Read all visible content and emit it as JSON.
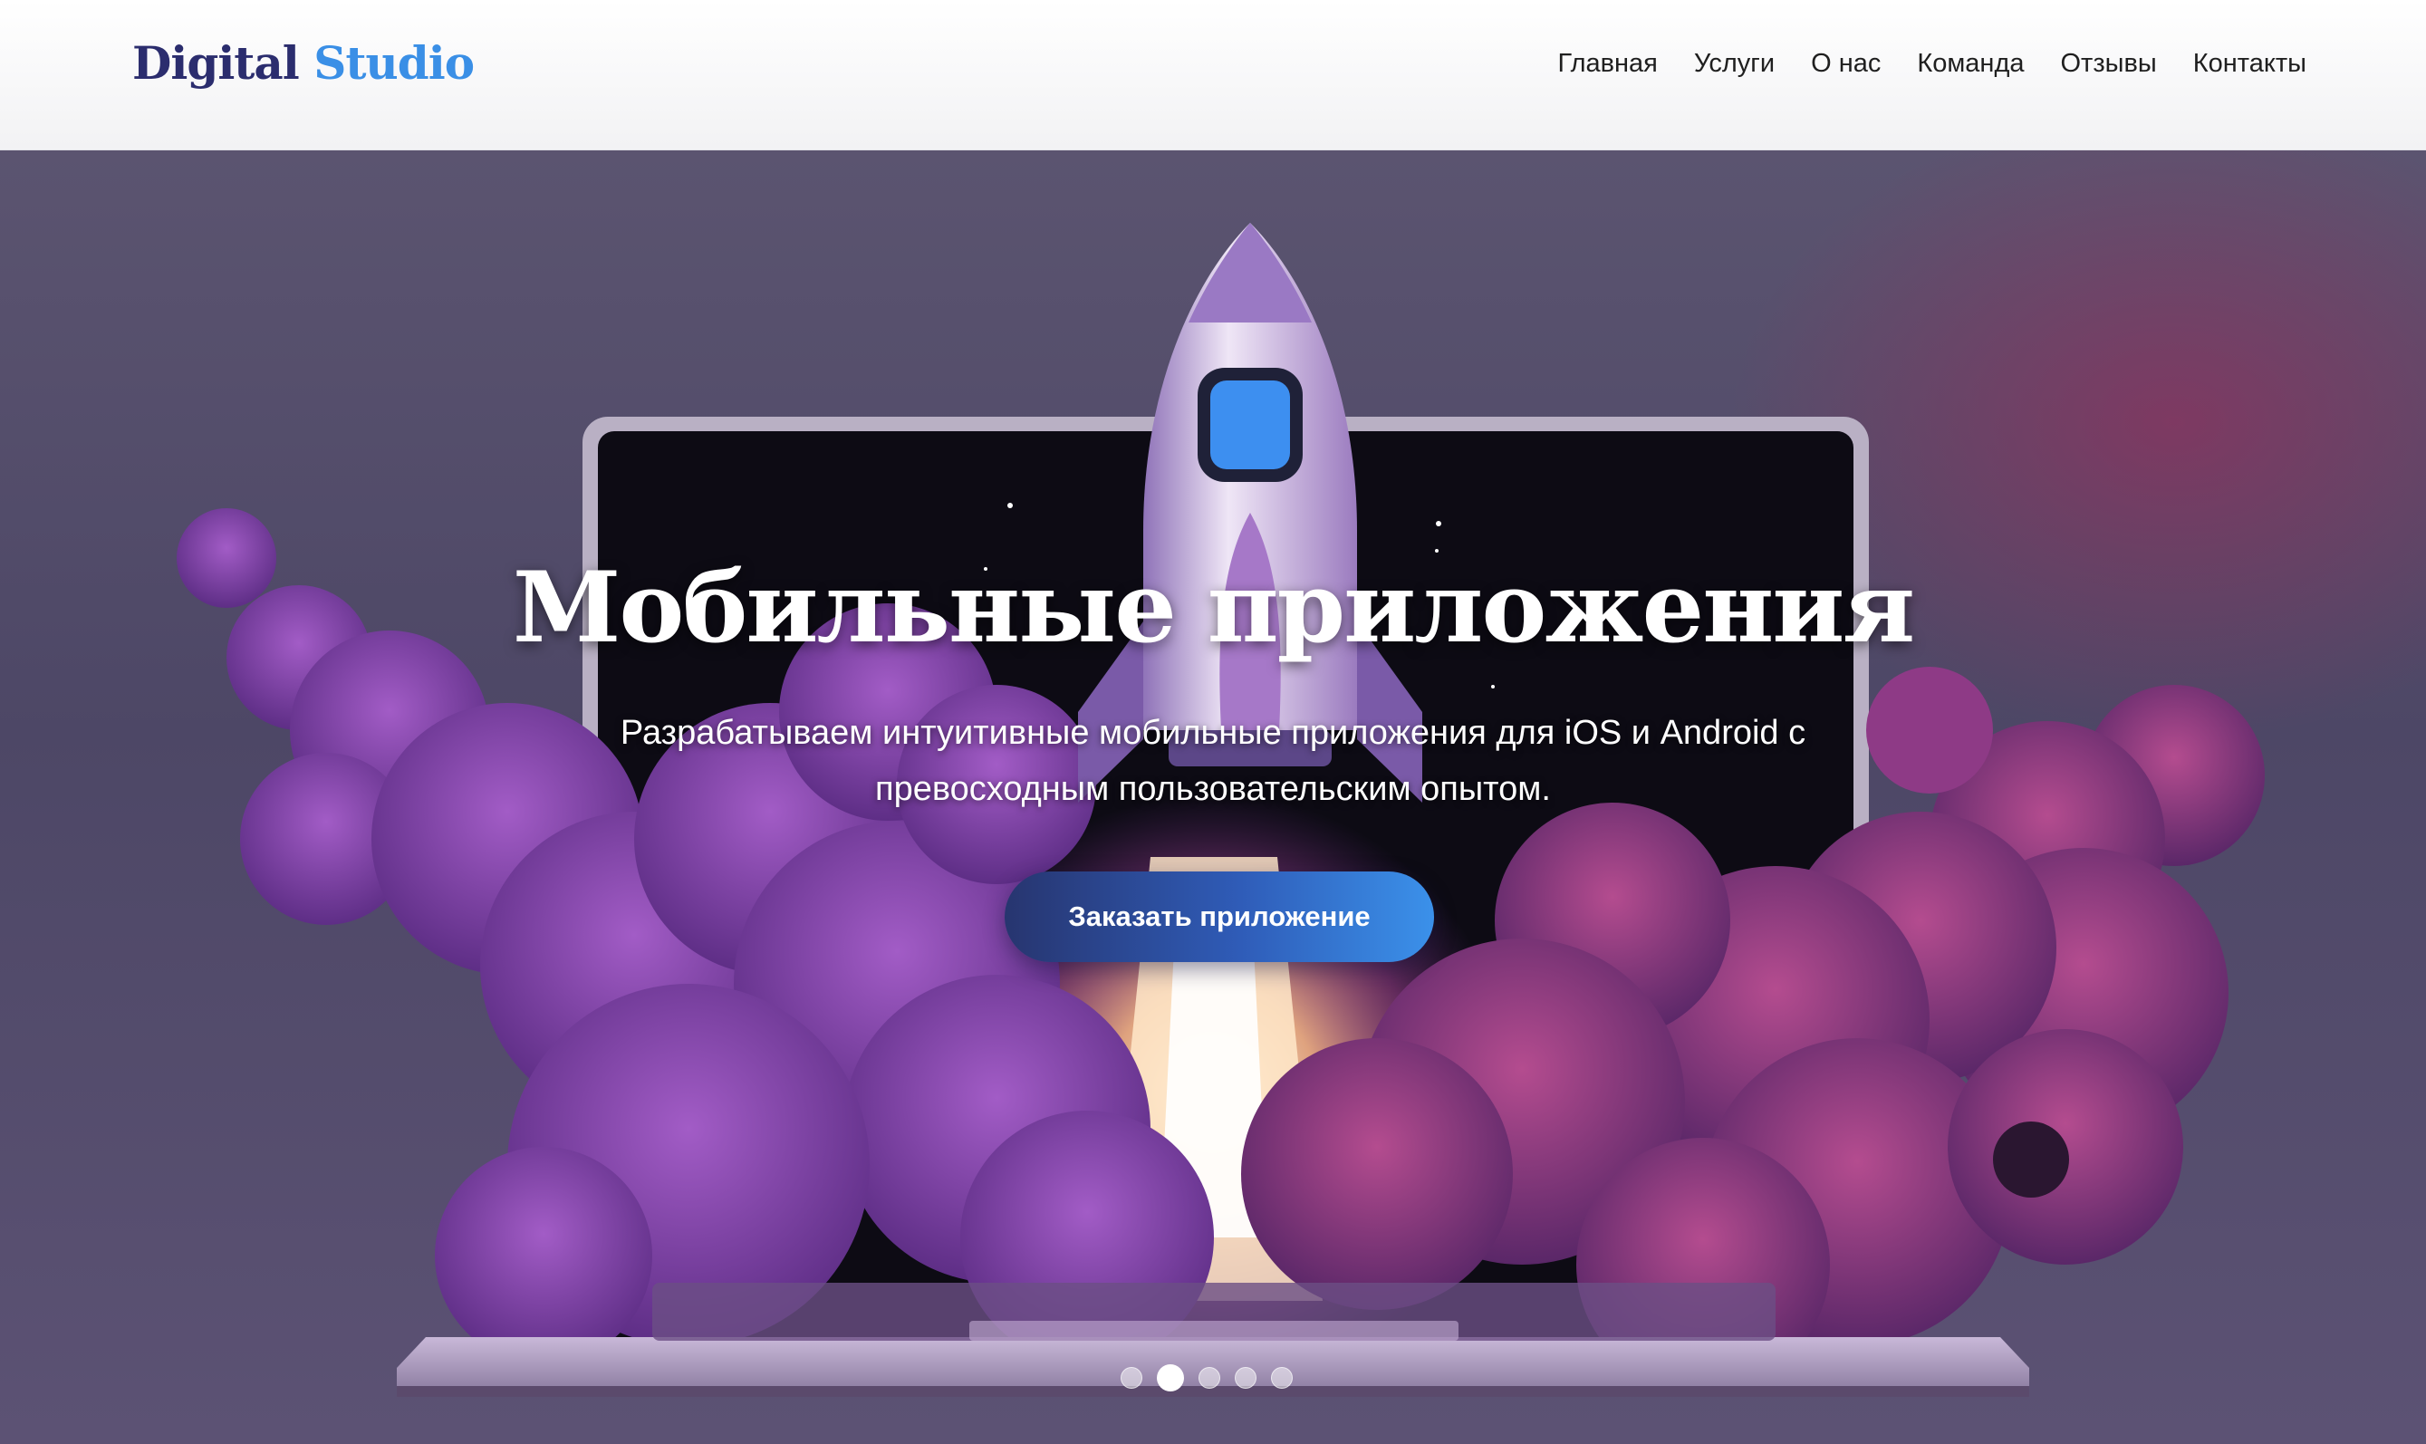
{
  "header": {
    "logo_word1": "Digital",
    "logo_word2": "Studio",
    "nav": [
      "Главная",
      "Услуги",
      "О нас",
      "Команда",
      "Отзывы",
      "Контакты"
    ]
  },
  "hero": {
    "title": "Мобильные приложения",
    "subtitle": "Разрабатываем интуитивные мобильные приложения для iOS и Android с превосходным пользовательским опытом.",
    "button_label": "Заказать приложение",
    "slides_total": 5,
    "active_slide": 2,
    "image_subject": "rocket-launching-from-laptop"
  },
  "colors": {
    "logo_primary": "#2b2d6e",
    "logo_accent": "#3a8fe6",
    "button_gradient_start": "#27356f",
    "button_gradient_end": "#3b91ea"
  }
}
